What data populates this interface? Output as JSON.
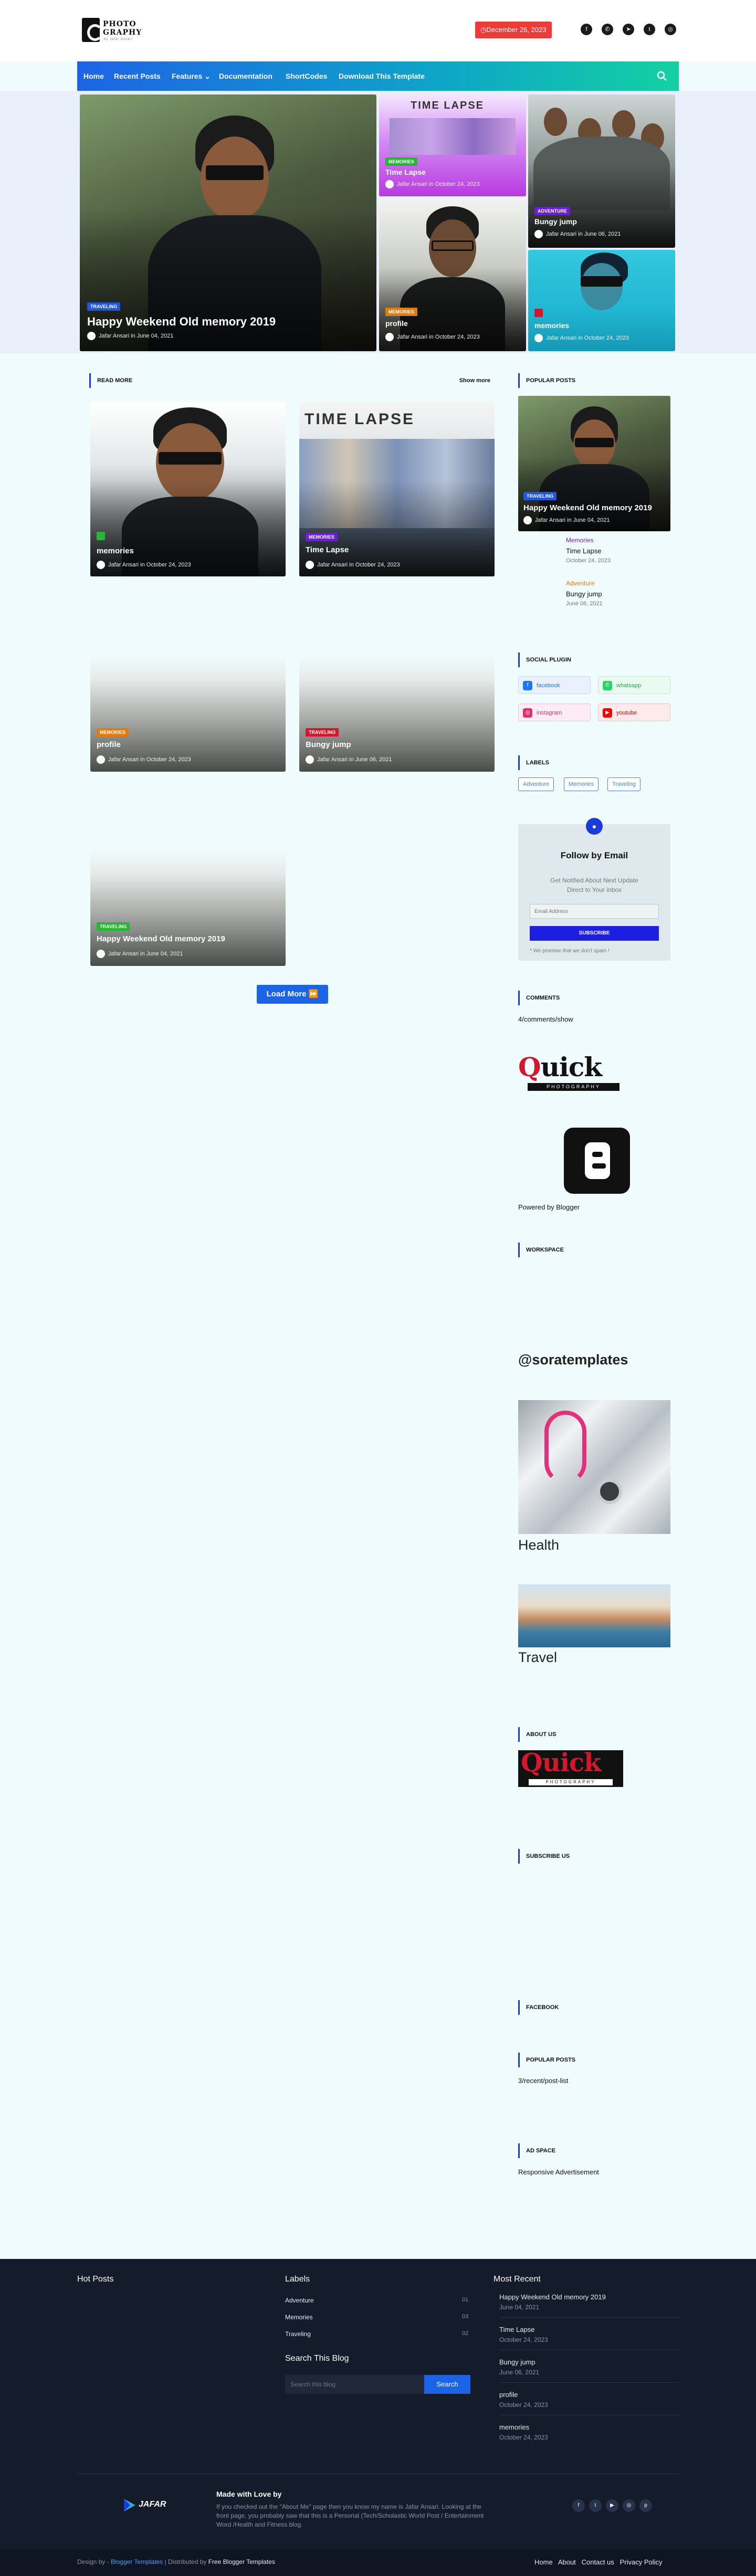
{
  "header": {
    "logo": {
      "line1": "PHOTO",
      "line2": "GRAPHY",
      "line3": "by Jafar Ansari"
    },
    "date": "December 26, 2023",
    "social_icons": [
      "facebook-icon",
      "whatsapp-icon",
      "telegram-icon",
      "twitter-icon",
      "instagram-icon"
    ]
  },
  "nav": {
    "items": [
      "Home",
      "Recent Posts",
      "Features",
      "Documentation",
      "ShortCodes",
      "Download This Template"
    ]
  },
  "hero": {
    "main": {
      "tag": "TRAVELING",
      "title": "Happy Weekend Old memory 2019",
      "author": "Jafar Ansari",
      "date": "June 04, 2021"
    },
    "tl": {
      "tag": "MEMORIES",
      "title": "Time Lapse",
      "author": "Jafar Ansari",
      "date": "October 24, 2023",
      "image_text": "TIME LAPSE"
    },
    "tr": {
      "tag": "ADVENTURE",
      "title": "Bungy jump",
      "author": "Jafar Ansari",
      "date": "June 06, 2021"
    },
    "bl": {
      "tag": "MEMORIES",
      "title": "profile",
      "author": "Jafar Ansari",
      "date": "October 24, 2023"
    },
    "br": {
      "title": "memories",
      "author": "Jafar Ansari",
      "date": "October 24, 2023"
    }
  },
  "read_more": {
    "heading": "READ MORE",
    "show_more": "Show more",
    "posts": [
      {
        "title": "memories",
        "author": "Jafar Ansari",
        "date": "October 24, 2023"
      },
      {
        "tag": "MEMORIES",
        "title": "Time Lapse",
        "author": "Jafar Ansari",
        "date": "October 24, 2023",
        "image_text": "TIME LAPSE"
      },
      {
        "tag": "MEMORIES",
        "title": "profile",
        "author": "Jafar Ansari",
        "date": "October 24, 2023"
      },
      {
        "tag": "TRAVELING",
        "title": "Bungy jump",
        "author": "Jafar Ansari",
        "date": "June 06, 2021"
      },
      {
        "tag": "TRAVELING",
        "title": "Happy Weekend Old memory 2019",
        "author": "Jafar Ansari",
        "date": "June 04, 2021"
      }
    ],
    "load_more": "Load More"
  },
  "sidebar": {
    "popular_heading": "POPULAR POSTS",
    "popular_main": {
      "tag": "TRAVELING",
      "title": "Happy Weekend Old memory 2019",
      "author": "Jafar Ansari",
      "date": "June 04, 2021"
    },
    "popular_list": [
      {
        "category": "Memories",
        "title": "Time Lapse",
        "date": "October 24, 2023"
      },
      {
        "category": "Adventure",
        "title": "Bungy jump",
        "date": "June 06, 2021"
      }
    ],
    "social_heading": "SOCIAL PLUGIN",
    "social": [
      {
        "label": "facebook",
        "color": "#1877f2"
      },
      {
        "label": "whatsapp",
        "color": "#25d366"
      },
      {
        "label": "instagram",
        "color": "#e1306c"
      },
      {
        "label": "youtube",
        "color": "#ff0000"
      }
    ],
    "labels_heading": "LABELS",
    "labels": [
      "Adventure",
      "Memories",
      "Traveling"
    ],
    "follow": {
      "title": "Follow by Email",
      "subtitle": "Get Notified About Next Update Direct to Your inbox",
      "placeholder": "Email Address",
      "button": "SUBSCRIBE",
      "note": "* We promise that we don't spam !"
    },
    "comments_heading": "COMMENTS",
    "comments_text": "4/comments/show",
    "quick_logo": {
      "big": "Quick",
      "small": "PHOTOGRAPHY"
    },
    "powered_by": "Powered by Blogger",
    "workspace_heading": "WORKSPACE",
    "sora": "@soratemplates",
    "health": "Health",
    "travel": "Travel",
    "about_heading": "ABOUT US",
    "subscribe_heading": "SUBSCRIBE US",
    "facebook_heading": "FACEBOOK",
    "popular2_heading": "POPULAR POSTS",
    "popular2_text": "3/recent/post-list",
    "ad_heading": "AD SPACE",
    "ad_text": "Responsive Advertisement"
  },
  "footer": {
    "hot_posts": "Hot Posts",
    "labels_title": "Labels",
    "labels": [
      {
        "name": "Adventure",
        "count": "01"
      },
      {
        "name": "Memories",
        "count": "03"
      },
      {
        "name": "Traveling",
        "count": "02"
      }
    ],
    "search_title": "Search This Blog",
    "search_placeholder": "Search this blog",
    "search_button": "Search",
    "most_recent": "Most Recent",
    "recent": [
      {
        "title": "Happy Weekend Old memory 2019",
        "date": "June 04, 2021"
      },
      {
        "title": "Time Lapse",
        "date": "October 24, 2023"
      },
      {
        "title": "Bungy jump",
        "date": "June 06, 2021"
      },
      {
        "title": "profile",
        "date": "October 24, 2023"
      },
      {
        "title": "memories",
        "date": "October 24, 2023"
      }
    ],
    "brand": "JAFAR",
    "made_with": "Made with Love by",
    "about_text": "If you checked out the \"About Me\" page then you know my name is Jafar Ansari. Looking at the front page, you probably saw that this is a Personal (Tech/Scholastic World Post / Entertainment Word /Health and Fitness blog.",
    "design_by_prefix": "Design by -",
    "design_by_link": "Blogger Templates",
    "distributed_prefix": "| Distributed by",
    "distributed_link": "Free Blogger Templates",
    "links": [
      "Home",
      "About",
      "Contact us",
      "Privacy Policy"
    ]
  },
  "colors": {
    "accent_blue": "#1b3bd8",
    "date_red": "#f03a3a",
    "tag_blue": "#2156d8",
    "tag_green": "#28b437",
    "tag_orange": "#e07b10",
    "tag_purple": "#6a1fd1",
    "tag_red": "#d3172d",
    "footer_bg": "#141b2b"
  }
}
